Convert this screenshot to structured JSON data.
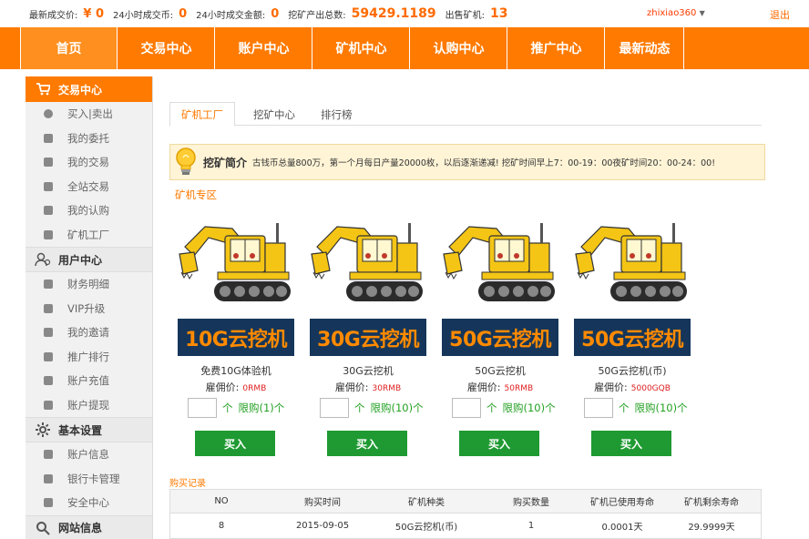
{
  "topbar": {
    "last_price_label": "最新成交价:",
    "last_price_value": "¥ 0",
    "coins_24h_label": "24小时成交币:",
    "coins_24h_value": "0",
    "amount_24h_label": "24小时成交金额:",
    "amount_24h_value": "0",
    "mining_total_label": "挖矿产出总数:",
    "mining_total_value": "59429.1189",
    "miners_sold_label": "出售矿机:",
    "miners_sold_value": "13",
    "username": "zhixiao360",
    "logout": "退出"
  },
  "nav": {
    "items": [
      {
        "label": "首页"
      },
      {
        "label": "交易中心"
      },
      {
        "label": "账户中心"
      },
      {
        "label": "矿机中心"
      },
      {
        "label": "认购中心"
      },
      {
        "label": "推广中心"
      },
      {
        "label": "最新动态"
      }
    ]
  },
  "sidebar": {
    "trade_header": "交易中心",
    "trade_items": [
      "买入|卖出",
      "我的委托",
      "我的交易",
      "全站交易",
      "我的认购",
      "矿机工厂"
    ],
    "user_header": "用户中心",
    "user_items": [
      "财务明细",
      "VIP升级",
      "我的邀请",
      "推广排行",
      "账户充值",
      "账户提现"
    ],
    "settings_header": "基本设置",
    "settings_items": [
      "账户信息",
      "银行卡管理",
      "安全中心"
    ],
    "site_header": "网站信息"
  },
  "tabs": [
    "矿机工厂",
    "挖矿中心",
    "排行榜"
  ],
  "notice": {
    "title": "挖矿简介",
    "text": "古钱币总量800万，第一个月每日产量20000枚，以后逐渐递减! 挖矿时间早上7：00-19：00夜矿时间20：00-24：00!"
  },
  "section_title": "矿机专区",
  "cards": [
    {
      "banner": "10G云挖机",
      "name": "免费10G体验机",
      "price_label": "雇佣价:",
      "price": "0RMB",
      "unit": "个",
      "limit": "限购(1)个",
      "buy": "买入"
    },
    {
      "banner": "30G云挖机",
      "name": "30G云挖机",
      "price_label": "雇佣价:",
      "price": "30RMB",
      "unit": "个",
      "limit": "限购(10)个",
      "buy": "买入"
    },
    {
      "banner": "50G云挖机",
      "name": "50G云挖机",
      "price_label": "雇佣价:",
      "price": "50RMB",
      "unit": "个",
      "limit": "限购(10)个",
      "buy": "买入"
    },
    {
      "banner": "50G云挖机",
      "name": "50G云挖机(币)",
      "price_label": "雇佣价:",
      "price": "5000GQB",
      "unit": "个",
      "limit": "限购(10)个",
      "buy": "买入"
    }
  ],
  "records": {
    "title": "购买记录",
    "headers": [
      "NO",
      "购买时间",
      "矿机种类",
      "购买数量",
      "矿机已使用寿命",
      "矿机剩余寿命"
    ],
    "rows": [
      [
        "8",
        "2015-09-05",
        "50G云挖机(币)",
        "1",
        "0.0001天",
        "29.9999天"
      ]
    ]
  },
  "colors": {
    "brand_orange": "#ff7a00",
    "buy_green": "#1f9a32",
    "banner_navy": "#15365a"
  }
}
